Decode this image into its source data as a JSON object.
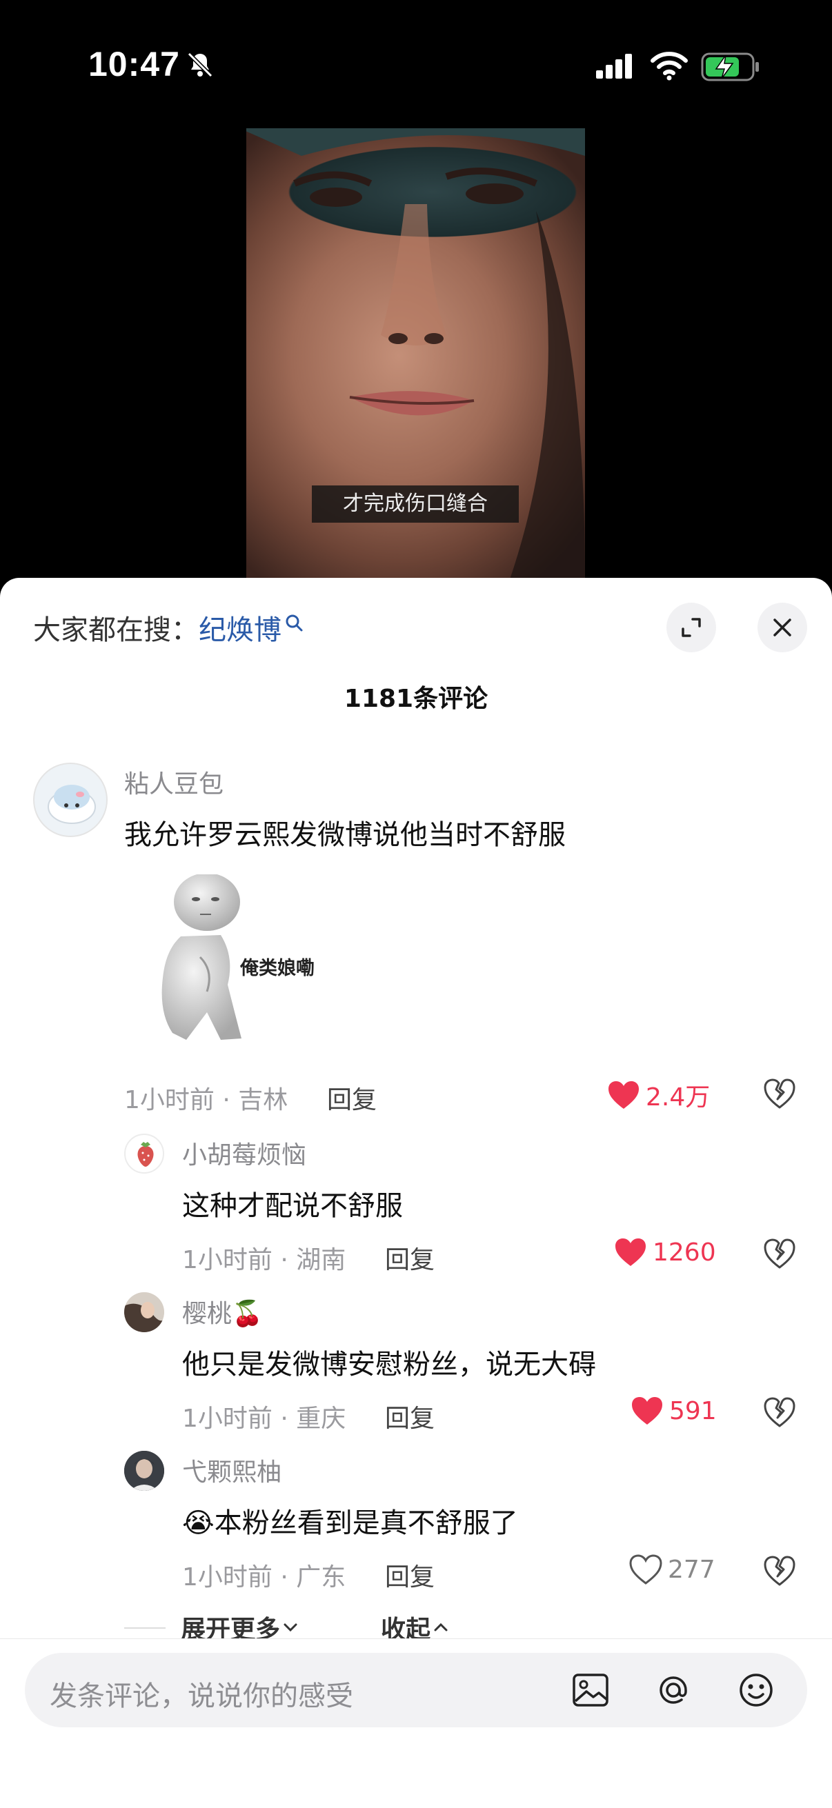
{
  "status_bar": {
    "time": "10:47"
  },
  "video": {
    "subtitle": "才完成伤口缝合"
  },
  "sheet": {
    "search_prefix": "大家都在搜：",
    "search_term": "纪焕博",
    "comment_count": "1181条评论",
    "comments": [
      {
        "username": "粘人豆包",
        "text": "我允许罗云熙发微博说他当时不舒服",
        "sticker_text": "俺类娘嘞",
        "meta": "1小时前 · 吉林",
        "reply": "回复",
        "likes": "2.4万",
        "liked": true
      },
      {
        "username": "小胡莓烦恼",
        "text": "这种才配说不舒服",
        "meta": "1小时前 · 湖南",
        "reply": "回复",
        "likes": "1260",
        "liked": true
      },
      {
        "username": "樱桃🍒",
        "text": "他只是发微博安慰粉丝，说无大碍",
        "meta": "1小时前 · 重庆",
        "reply": "回复",
        "likes": "591",
        "liked": true
      },
      {
        "username": "弋颗熙柚",
        "text": "😭本粉丝看到是真不舒服了",
        "meta": "1小时前 · 广东",
        "reply": "回复",
        "likes": "277",
        "liked": false
      }
    ],
    "expand_more": "展开更多",
    "collapse": "收起"
  },
  "input": {
    "placeholder": "发条评论，说说你的感受"
  },
  "icons": [
    "bell-off-icon",
    "signal-icon",
    "wifi-icon",
    "battery-charging-icon",
    "search-icon",
    "expand-icon",
    "close-icon",
    "heart-icon",
    "broken-heart-icon",
    "image-icon",
    "at-icon",
    "emoji-icon"
  ],
  "colors": {
    "accent_like": "#ee3552",
    "search_term": "#2a5aa8",
    "battery": "#34c759"
  }
}
